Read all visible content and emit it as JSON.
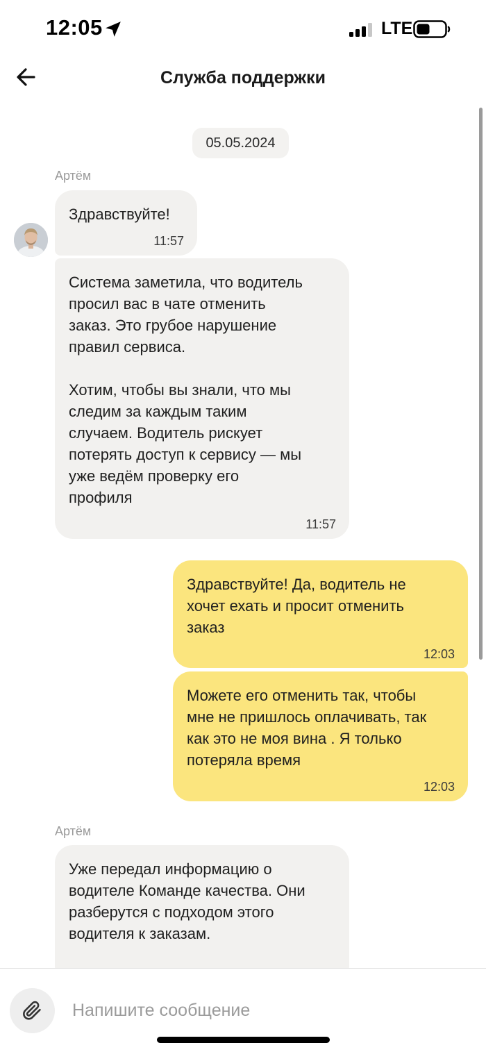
{
  "status_bar": {
    "time": "12:05",
    "network": "LTE",
    "icons": [
      "location-arrow-icon",
      "cellular-signal-icon",
      "battery-icon"
    ]
  },
  "header": {
    "title": "Служба поддержки",
    "back_icon": "arrow-left-icon"
  },
  "chat": {
    "date": "05.05.2024",
    "groups": [
      {
        "sender": "Артём",
        "messages": [
          {
            "text": "Здравствуйте!",
            "time": "11:57"
          },
          {
            "text": "Система заметила, что водитель\nпросил вас в чате отменить\nзаказ. Это грубое нарушение\nправил сервиса.\n\nХотим, чтобы вы знали, что мы\nследим за каждым таким\nслучаем. Водитель рискует\nпотерять доступ к сервису — мы\nуже ведём проверку его\nпрофиля",
            "time": "11:57"
          }
        ]
      },
      {
        "sender": "me",
        "messages": [
          {
            "text": "Здравствуйте! Да, водитель не\nхочет ехать и просит отменить\nзаказ",
            "time": "12:03"
          },
          {
            "text": "Можете его отменить так, чтобы\nмне не пришлось оплачивать, так\nкак это не моя вина . Я только\nпотеряла время",
            "time": "12:03"
          }
        ]
      },
      {
        "sender": "Артём",
        "messages": [
          {
            "text": "Уже передал информацию о\nводителе Команде качества. Они\nразберутся с подходом этого\nводителя к заказам."
          }
        ]
      }
    ]
  },
  "composer": {
    "placeholder": "Напишите сообщение",
    "value": "",
    "attach_icon": "paperclip-icon"
  },
  "colors": {
    "incoming_bubble": "#f2f1ef",
    "outgoing_bubble": "#fbe57e",
    "date_chip": "#f3f2f0",
    "sender_name": "#9a9a9a"
  }
}
